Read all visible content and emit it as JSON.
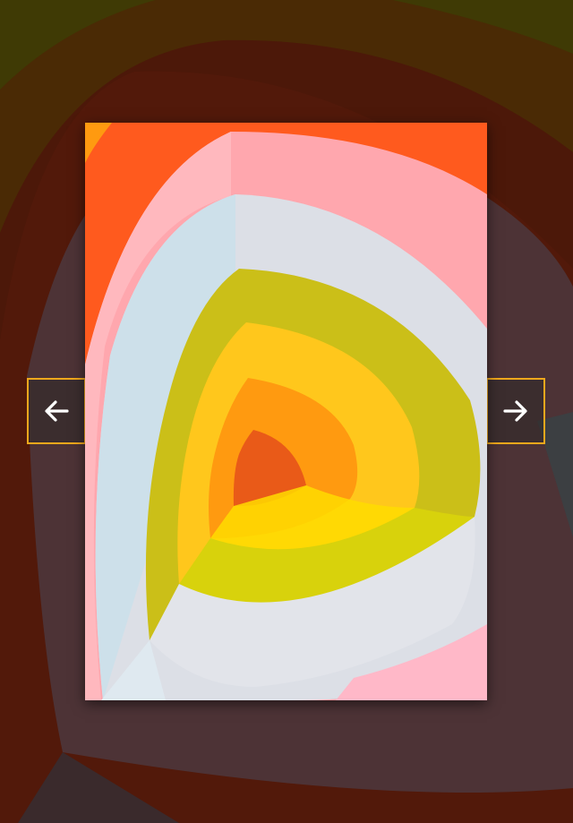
{
  "lightbox": {
    "prev_button": {
      "icon": "arrow-left-icon"
    },
    "next_button": {
      "icon": "arrow-right-icon"
    },
    "photo": {
      "subject": "colorful-corner-photo"
    },
    "colors": {
      "accent_border": "#f0a81c",
      "icon": "#ffffff"
    }
  }
}
